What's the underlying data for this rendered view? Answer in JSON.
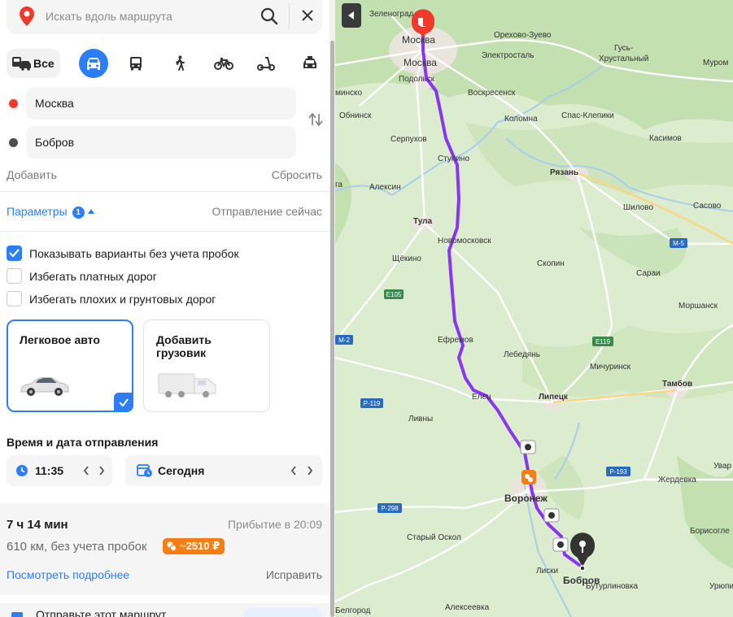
{
  "search": {
    "placeholder": "Искать вдоль маршрута"
  },
  "modes": {
    "all_label": "Все"
  },
  "route": {
    "from": "Москва",
    "to": "Бобров",
    "add_label": "Добавить",
    "reset_label": "Сбросить"
  },
  "params": {
    "label": "Параметры",
    "badge": "1",
    "departure": "Отправление сейчас"
  },
  "options": [
    {
      "label": "Показывать варианты без учета пробок",
      "checked": true
    },
    {
      "label": "Избегать платных дорог",
      "checked": false
    },
    {
      "label": "Избегать плохих и грунтовых дорог",
      "checked": false
    }
  ],
  "vehicles": {
    "car": "Легковое авто",
    "truck": "Добавить грузовик"
  },
  "time": {
    "label": "Время и дата отправления",
    "value": "11:35",
    "date": "Сегодня"
  },
  "summary": {
    "duration": "7 ч 14 мин",
    "arrival": "Прибытие в 20:09",
    "distance": "610 км, без учета пробок",
    "toll": "~2510 ₽",
    "details": "Посмотреть подробнее",
    "fix": "Исправить",
    "send": "Отправьте этот маршрут"
  },
  "colors": {
    "accent": "#2d7ef6",
    "route": "#8a35f0",
    "start": "#f0392b",
    "end": "#4d4d4d",
    "toll": "#f57f17"
  },
  "map": {
    "labels": [
      {
        "id": "zelenograd",
        "text": "Зеленоград"
      },
      {
        "id": "moskva-top",
        "text": "Москва"
      },
      {
        "id": "moskva",
        "text": "Москва"
      },
      {
        "id": "orekhovo",
        "text": "Орехово-Зуево"
      },
      {
        "id": "elektrostal",
        "text": "Электросталь"
      },
      {
        "id": "gus",
        "text": "Гусь-"
      },
      {
        "id": "gus2",
        "text": "Хрустальный"
      },
      {
        "id": "murom",
        "text": "Муром"
      },
      {
        "id": "podolsk",
        "text": "Подольск"
      },
      {
        "id": "minsko",
        "text": "минско"
      },
      {
        "id": "voskresensk",
        "text": "Воскресенск"
      },
      {
        "id": "obninsk",
        "text": "Обнинск"
      },
      {
        "id": "kolomna",
        "text": "Коломна"
      },
      {
        "id": "spas",
        "text": "Спас-Клепики"
      },
      {
        "id": "serpukhov",
        "text": "Серпухов"
      },
      {
        "id": "kasimov",
        "text": "Касимов"
      },
      {
        "id": "stupino",
        "text": "Ступино"
      },
      {
        "id": "ryazan",
        "text": "Рязань"
      },
      {
        "id": "ga",
        "text": "га"
      },
      {
        "id": "aleksin",
        "text": "Алексин"
      },
      {
        "id": "shilovo",
        "text": "Шилово"
      },
      {
        "id": "sasovo",
        "text": "Сасово"
      },
      {
        "id": "tula",
        "text": "Тула"
      },
      {
        "id": "novomoskovsk",
        "text": "Новомосковск"
      },
      {
        "id": "shchekino",
        "text": "Щёкино"
      },
      {
        "id": "skopin",
        "text": "Скопин"
      },
      {
        "id": "sarai",
        "text": "Сараи"
      },
      {
        "id": "morshansk",
        "text": "Моршанск"
      },
      {
        "id": "efremov",
        "text": "Ефремов"
      },
      {
        "id": "lebedyan",
        "text": "Лебедянь"
      },
      {
        "id": "michurinsk",
        "text": "Мичуринск"
      },
      {
        "id": "tambov",
        "text": "Тамбов"
      },
      {
        "id": "elets",
        "text": "Елец"
      },
      {
        "id": "lipetsk",
        "text": "Липецк"
      },
      {
        "id": "livny",
        "text": "Ливны"
      },
      {
        "id": "uvar",
        "text": "Увар"
      },
      {
        "id": "zherdevka",
        "text": "Жердевка"
      },
      {
        "id": "voronezh",
        "text": "Воронеж"
      },
      {
        "id": "stary-oskol",
        "text": "Старый Оскол"
      },
      {
        "id": "borisogl",
        "text": "Борисогле"
      },
      {
        "id": "liski",
        "text": "Лиски"
      },
      {
        "id": "bobrov",
        "text": "Бобров"
      },
      {
        "id": "buturlinovka",
        "text": "Бутурлиновка"
      },
      {
        "id": "uryupinsk",
        "text": "Урюпинс"
      },
      {
        "id": "belgorod",
        "text": "Белгород"
      },
      {
        "id": "alekseevka",
        "text": "Алексеевка"
      }
    ],
    "shields": [
      {
        "id": "e105",
        "text": "E105"
      },
      {
        "id": "m2",
        "text": "М-2"
      },
      {
        "id": "m5",
        "text": "М-5"
      },
      {
        "id": "e119",
        "text": "E119"
      },
      {
        "id": "p119",
        "text": "Р-119"
      },
      {
        "id": "p193",
        "text": "Р-193"
      },
      {
        "id": "p298",
        "text": "Р-298"
      }
    ]
  }
}
